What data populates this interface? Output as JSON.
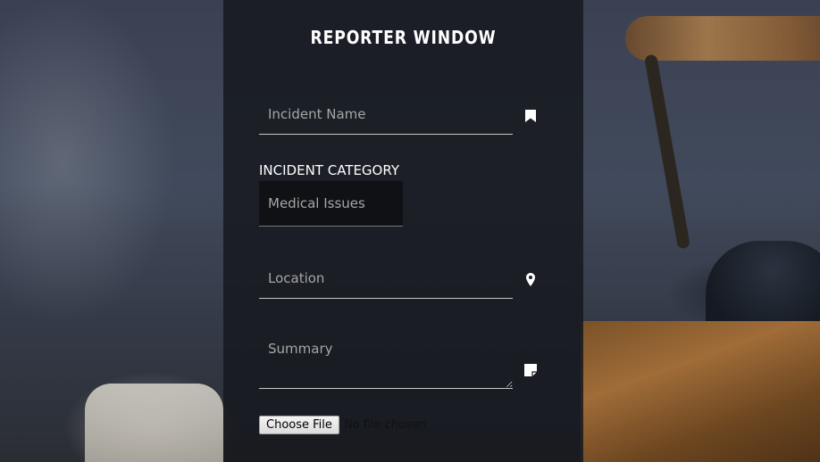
{
  "form": {
    "title": "REPORTER WINDOW",
    "incident_name": {
      "value": "",
      "placeholder": "Incident Name",
      "icon": "bookmark-icon"
    },
    "incident_category": {
      "label": "INCIDENT CATEGORY",
      "selected": "Medical Issues"
    },
    "location": {
      "value": "",
      "placeholder": "Location",
      "icon": "map-pin-icon"
    },
    "summary": {
      "value": "",
      "placeholder": "Summary",
      "icon": "note-icon"
    },
    "file_upload": {
      "button_label": "Choose File",
      "status": "No file chosen"
    }
  },
  "colors": {
    "panel": "#16181e",
    "text": "#ffffff",
    "placeholder": "#a6a6a6"
  }
}
